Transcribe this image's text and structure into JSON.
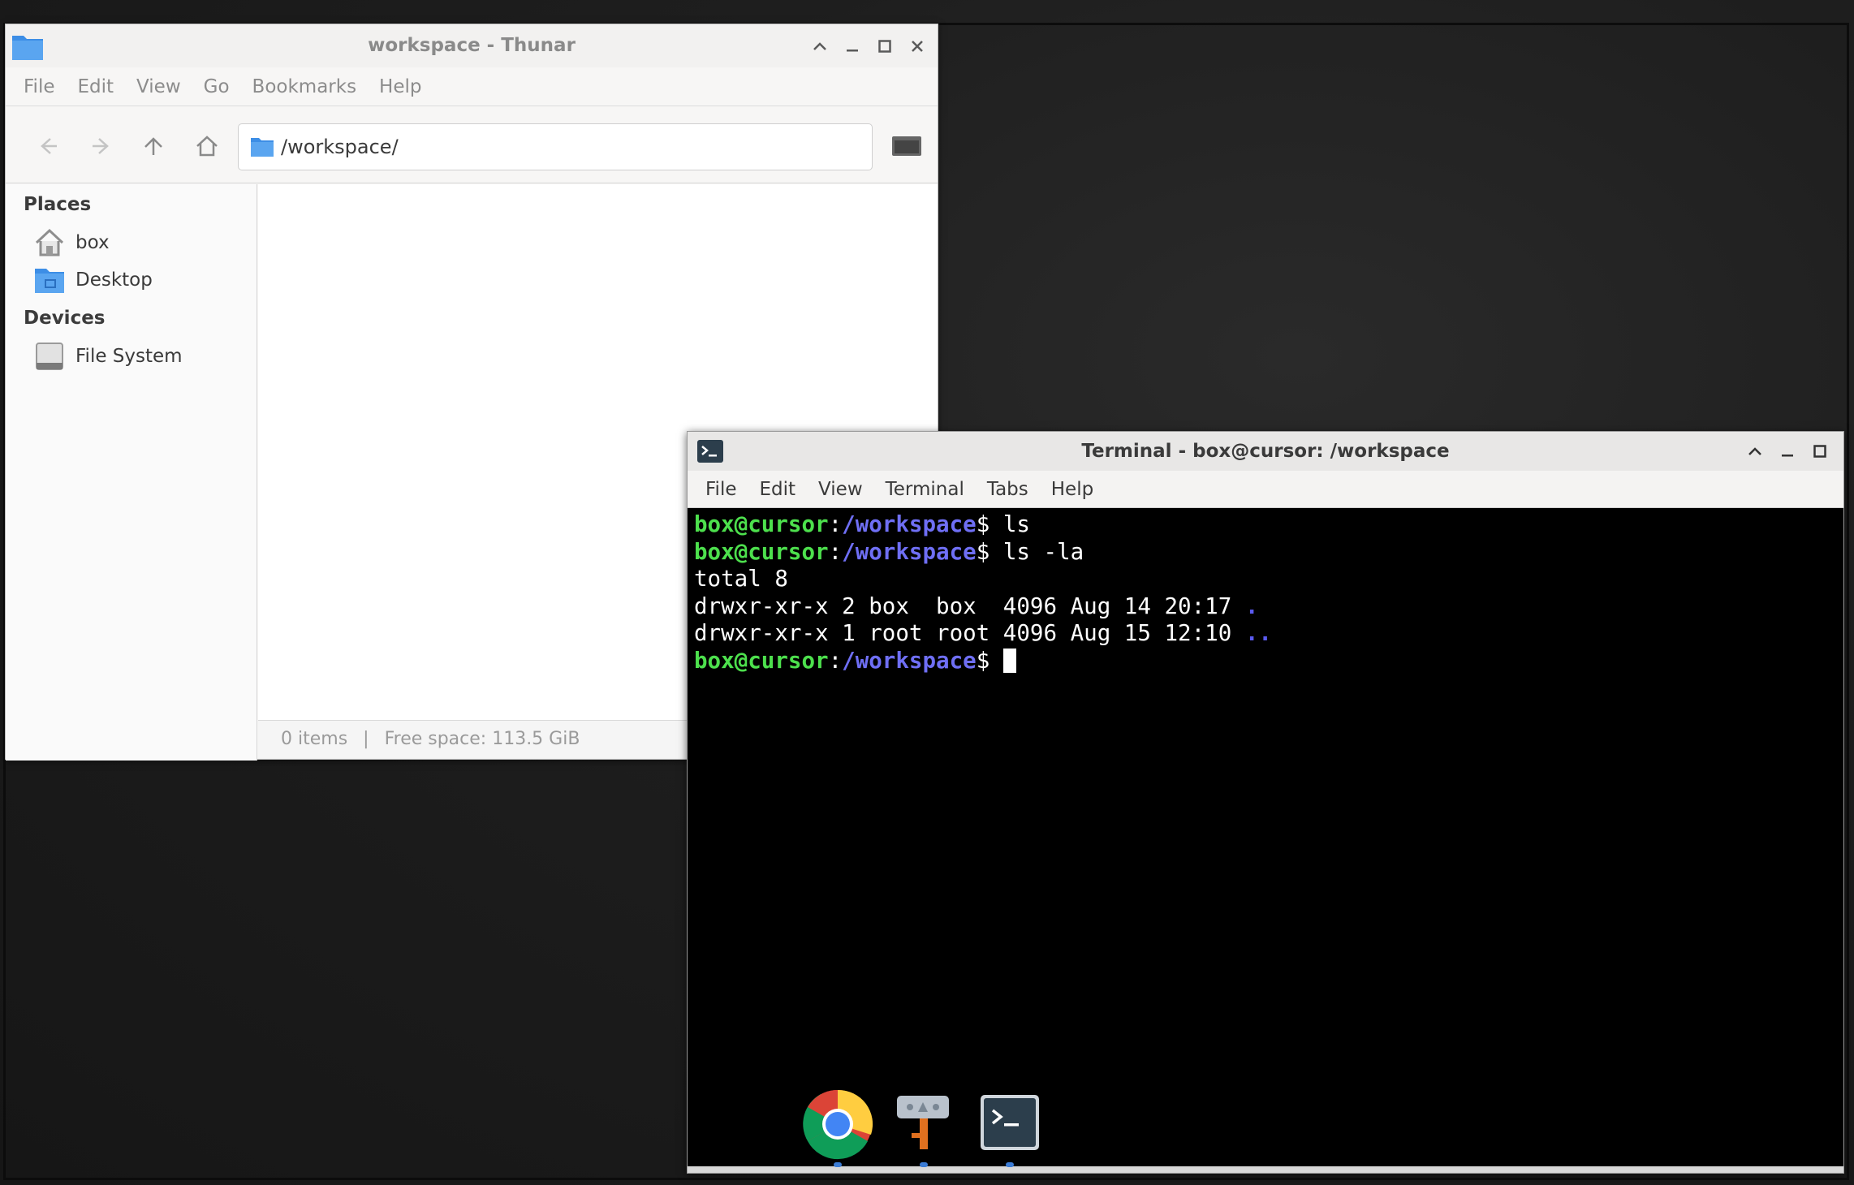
{
  "thunar": {
    "title": "workspace - Thunar",
    "menu": [
      "File",
      "Edit",
      "View",
      "Go",
      "Bookmarks",
      "Help"
    ],
    "path": "/workspace/",
    "sidebar": {
      "places_heading": "Places",
      "places": [
        {
          "label": "box",
          "icon": "home-icon"
        },
        {
          "label": "Desktop",
          "icon": "desktop-folder-icon"
        }
      ],
      "devices_heading": "Devices",
      "devices": [
        {
          "label": "File System",
          "icon": "drive-icon"
        }
      ]
    },
    "status": {
      "items": "0 items",
      "separator": "|",
      "free_space": "Free space: 113.5 GiB"
    }
  },
  "terminal": {
    "title": "Terminal - box@cursor: /workspace",
    "menu": [
      "File",
      "Edit",
      "View",
      "Terminal",
      "Tabs",
      "Help"
    ],
    "prompt_user": "box@cursor",
    "prompt_colon": ":",
    "prompt_path": "/workspace",
    "prompt_symbol": "$",
    "lines": [
      {
        "type": "prompt",
        "command": " ls"
      },
      {
        "type": "prompt",
        "command": " ls -la"
      },
      {
        "type": "output",
        "text": "total 8"
      },
      {
        "type": "listing",
        "text": "drwxr-xr-x 2 box  box  4096 Aug 14 20:17 ",
        "name": "."
      },
      {
        "type": "listing",
        "text": "drwxr-xr-x 1 root root 4096 Aug 15 12:10 ",
        "name": ".."
      },
      {
        "type": "prompt",
        "command": " ",
        "cursor": true
      }
    ],
    "colors": {
      "user": "#4de04d",
      "path": "#6f6ff5",
      "dir": "#5a5af0"
    }
  },
  "dock": {
    "items": [
      {
        "name": "chrome-icon"
      },
      {
        "name": "app-finder-icon"
      },
      {
        "name": "terminal-icon"
      }
    ]
  }
}
